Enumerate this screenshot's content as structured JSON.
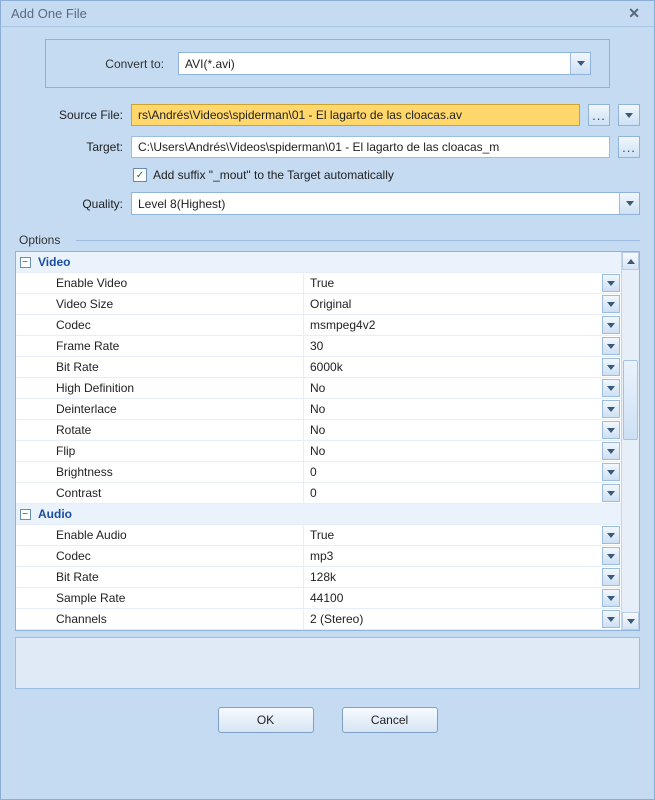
{
  "title": "Add One File",
  "convert": {
    "label": "Convert to:",
    "value": "AVI(*.avi)"
  },
  "source": {
    "label": "Source File:",
    "value": "rs\\Andrés\\Videos\\spiderman\\01 - El lagarto de las cloacas.av",
    "browse": "..."
  },
  "target": {
    "label": "Target:",
    "value": "C:\\Users\\Andrés\\Videos\\spiderman\\01 - El lagarto de las cloacas_m",
    "browse": "..."
  },
  "suffix": {
    "label": "Add suffix \"_mout\" to the Target automatically",
    "checked": true
  },
  "quality": {
    "label": "Quality:",
    "value": "Level 8(Highest)"
  },
  "optionsLabel": "Options",
  "sections": [
    {
      "name": "Video",
      "rows": [
        {
          "k": "Enable Video",
          "v": "True"
        },
        {
          "k": "Video Size",
          "v": "Original"
        },
        {
          "k": "Codec",
          "v": "msmpeg4v2"
        },
        {
          "k": "Frame Rate",
          "v": "30"
        },
        {
          "k": "Bit Rate",
          "v": "6000k"
        },
        {
          "k": "High Definition",
          "v": "No"
        },
        {
          "k": "Deinterlace",
          "v": "No"
        },
        {
          "k": "Rotate",
          "v": "No"
        },
        {
          "k": "Flip",
          "v": "No"
        },
        {
          "k": "Brightness",
          "v": "0"
        },
        {
          "k": "Contrast",
          "v": "0"
        }
      ]
    },
    {
      "name": "Audio",
      "rows": [
        {
          "k": "Enable Audio",
          "v": "True"
        },
        {
          "k": "Codec",
          "v": "mp3"
        },
        {
          "k": "Bit Rate",
          "v": "128k"
        },
        {
          "k": "Sample Rate",
          "v": "44100"
        },
        {
          "k": "Channels",
          "v": "2 (Stereo)"
        }
      ]
    }
  ],
  "buttons": {
    "ok": "OK",
    "cancel": "Cancel"
  }
}
